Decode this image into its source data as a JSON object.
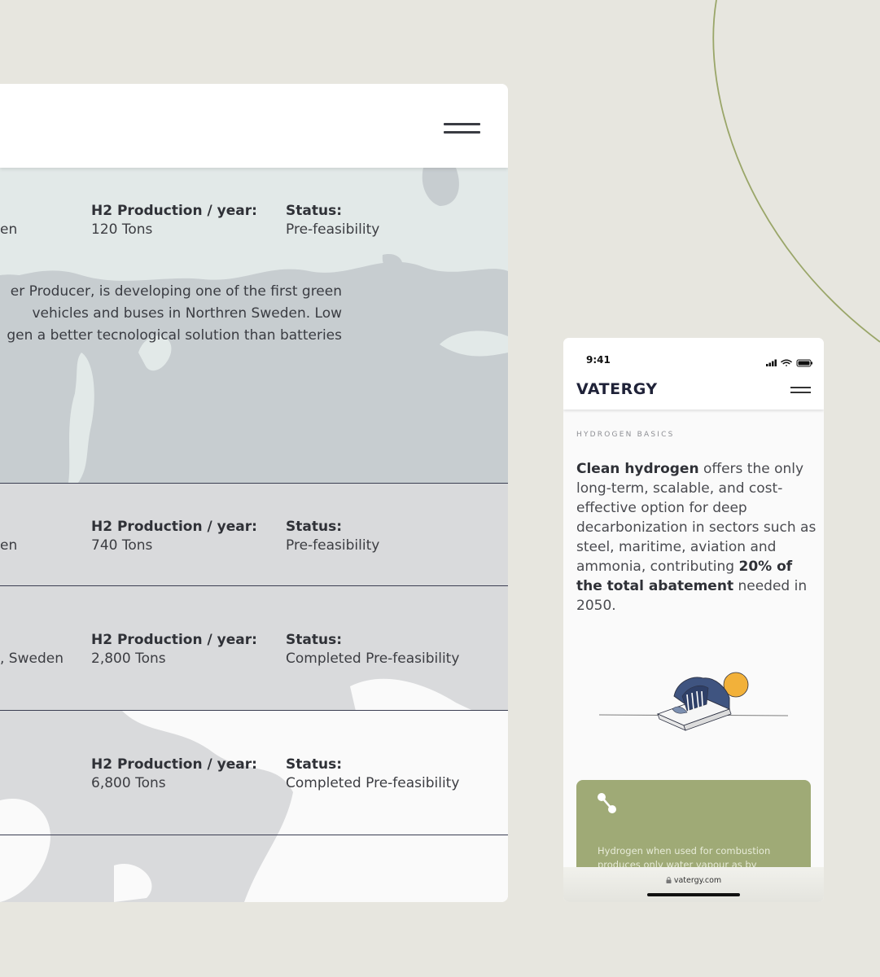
{
  "desktop": {
    "rows": [
      {
        "location": "en",
        "h2_label": "H2 Production / year:",
        "h2_value": "120 Tons",
        "status_label": "Status:",
        "status_value": "Pre-feasibility"
      },
      {
        "location": "en",
        "h2_label": "H2 Production / year:",
        "h2_value": "740 Tons",
        "status_label": "Status:",
        "status_value": "Pre-feasibility"
      },
      {
        "location": ", Sweden",
        "h2_label": "H2 Production / year:",
        "h2_value": "2,800 Tons",
        "status_label": "Status:",
        "status_value": "Completed Pre-feasibility"
      },
      {
        "location": "",
        "h2_label": "H2 Production / year:",
        "h2_value": "6,800 Tons",
        "status_label": "Status:",
        "status_value": "Completed Pre-feasibility"
      }
    ],
    "description_lines": [
      "er Producer, is developing one of the first green",
      "vehicles and buses in Northren Sweden. Low",
      "gen a better tecnological solution than batteries"
    ]
  },
  "phone": {
    "time": "9:41",
    "brand": "VATERGY",
    "section_label": "HYDROGEN BASICS",
    "intro": {
      "bold1": "Clean hydrogen",
      "text1": " offers the only long-term, scalable, and cost-effective option for deep decarbonization in sectors such as steel, maritime, aviation and ammonia, contributing ",
      "bold2": "20% of the total abatement",
      "text2": " needed in 2050."
    },
    "card_text": "Hydrogen when used for combustion produces only water vapour as by product.",
    "url": "vatergy.com",
    "icons": [
      "signal-icon",
      "wifi-icon",
      "battery-icon",
      "menu-icon",
      "molecule-icon",
      "lock-icon"
    ]
  },
  "colors": {
    "background": "#e7e6df",
    "accent_green": "#9faa76",
    "arc": "#9aa669",
    "brand_navy": "#1f2238"
  }
}
